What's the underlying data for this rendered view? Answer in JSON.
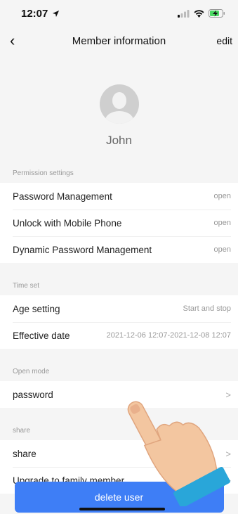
{
  "status_bar": {
    "time": "12:07",
    "location_arrow": "location-arrow-icon"
  },
  "nav": {
    "title": "Member information",
    "edit_label": "edit"
  },
  "profile": {
    "name": "John"
  },
  "permission": {
    "header": "Permission settings",
    "rows": [
      {
        "label": "Password Management",
        "value": "open"
      },
      {
        "label": "Unlock with Mobile Phone",
        "value": "open"
      },
      {
        "label": "Dynamic Password Management",
        "value": "open"
      }
    ]
  },
  "time_set": {
    "header": "Time set",
    "rows": [
      {
        "label": "Age setting",
        "value": "Start and stop"
      },
      {
        "label": "Effective date",
        "value": "2021-12-06 12:07-2021-12-08 12:07"
      }
    ]
  },
  "open_mode": {
    "header": "Open mode",
    "rows": [
      {
        "label": "password",
        "chevron": ">"
      }
    ]
  },
  "share": {
    "header": "share",
    "rows": [
      {
        "label": "share",
        "chevron": ">"
      },
      {
        "label": "Upgrade to family member",
        "chevron": ">"
      }
    ]
  },
  "actions": {
    "delete_label": "delete user"
  },
  "colors": {
    "accent": "#3e7ef6",
    "background": "#f5f5f5",
    "muted_text": "#999999"
  }
}
